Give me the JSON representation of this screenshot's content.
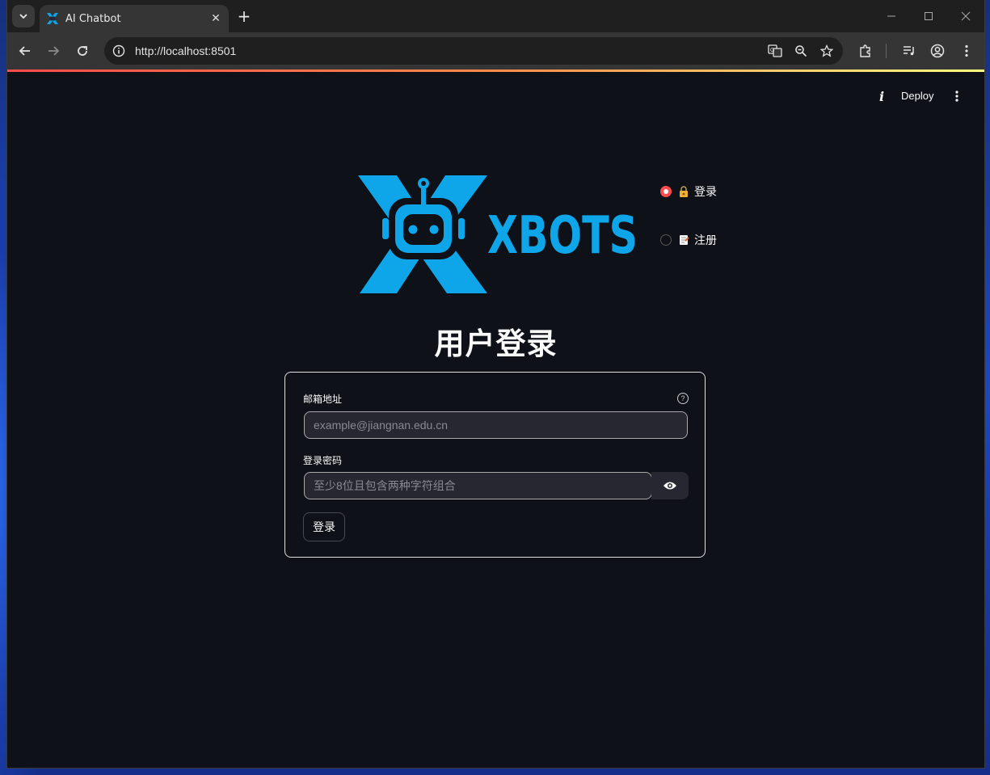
{
  "browser": {
    "tab_title": "AI Chatbot",
    "url": "http://localhost:8501",
    "loadbar_gradient": [
      "#ff4b4b",
      "#ff8a4b",
      "#fffd80"
    ]
  },
  "app_header": {
    "deploy_label": "Deploy"
  },
  "logo": {
    "text": "XBOTS",
    "color": "#0ea5e9"
  },
  "nav": {
    "options": [
      {
        "label": "登录",
        "selected": true,
        "icon": "lock-key-icon"
      },
      {
        "label": "注册",
        "selected": false,
        "icon": "memo-icon"
      }
    ],
    "accent": "#ff4b4b"
  },
  "page_title": "用户登录",
  "form": {
    "email_label": "邮箱地址",
    "email_placeholder": "example@jiangnan.edu.cn",
    "password_label": "登录密码",
    "password_placeholder": "至少8位且包含两种字符组合",
    "submit_label": "登录"
  }
}
